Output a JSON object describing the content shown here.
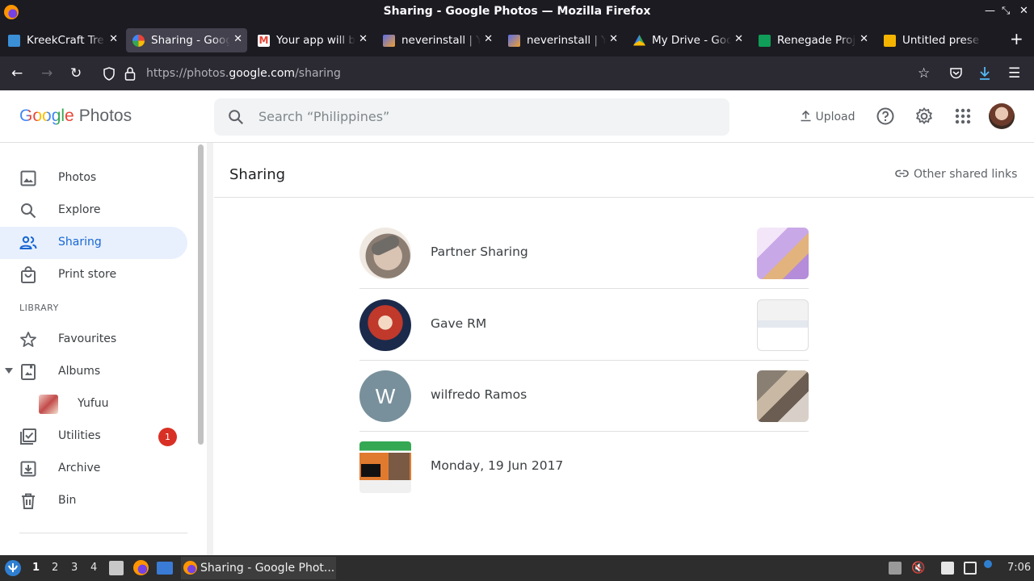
{
  "window": {
    "title": "Sharing - Google Photos — Mozilla Firefox"
  },
  "tabs": [
    {
      "label": "KreekCraft Tre",
      "favicon_color": "#3b8fd6"
    },
    {
      "label": "Sharing - Goog",
      "favicon_color": "#fbbc05",
      "active": true
    },
    {
      "label": "Your app will b",
      "favicon_color": "#ea4335"
    },
    {
      "label": "neverinstall | Y",
      "favicon_color": "#5b6ee8"
    },
    {
      "label": "neverinstall | Y",
      "favicon_color": "#5b6ee8"
    },
    {
      "label": "My Drive - Goo",
      "favicon_color": "#34a853"
    },
    {
      "label": "Renegade Proj",
      "favicon_color": "#0f9d58"
    },
    {
      "label": "Untitled prese",
      "favicon_color": "#f4b400"
    }
  ],
  "urlbar": {
    "prefix": "https://photos.",
    "domain": "google.com",
    "path": "/sharing"
  },
  "header": {
    "logo_word": "Google",
    "logo_product": "Photos",
    "search_placeholder": "Search “Philippines”",
    "upload_label": "Upload"
  },
  "sidebar": {
    "items": [
      {
        "label": "Photos",
        "icon": "photo-icon"
      },
      {
        "label": "Explore",
        "icon": "search-icon"
      },
      {
        "label": "Sharing",
        "icon": "people-icon",
        "active": true
      },
      {
        "label": "Print store",
        "icon": "shopping-bag-icon"
      }
    ],
    "library_label": "LIBRARY",
    "library_items": [
      {
        "label": "Favourites",
        "icon": "star-icon"
      },
      {
        "label": "Albums",
        "icon": "album-icon"
      },
      {
        "label": "Yufuu",
        "icon": "album-thumbnail"
      },
      {
        "label": "Utilities",
        "icon": "utilities-icon",
        "badge": "1"
      },
      {
        "label": "Archive",
        "icon": "archive-icon"
      },
      {
        "label": "Bin",
        "icon": "trash-icon"
      }
    ]
  },
  "main": {
    "title": "Sharing",
    "other_links_label": "Other shared links",
    "rows": [
      {
        "name": "Partner Sharing"
      },
      {
        "name": "Gave RM"
      },
      {
        "name": "wilfredo Ramos",
        "initial": "W"
      },
      {
        "name": "Monday, 19 Jun 2017"
      }
    ]
  },
  "taskbar": {
    "workspaces": [
      "1",
      "2",
      "3",
      "4"
    ],
    "task_label": "Sharing - Google Phot...",
    "clock": "7:06"
  }
}
